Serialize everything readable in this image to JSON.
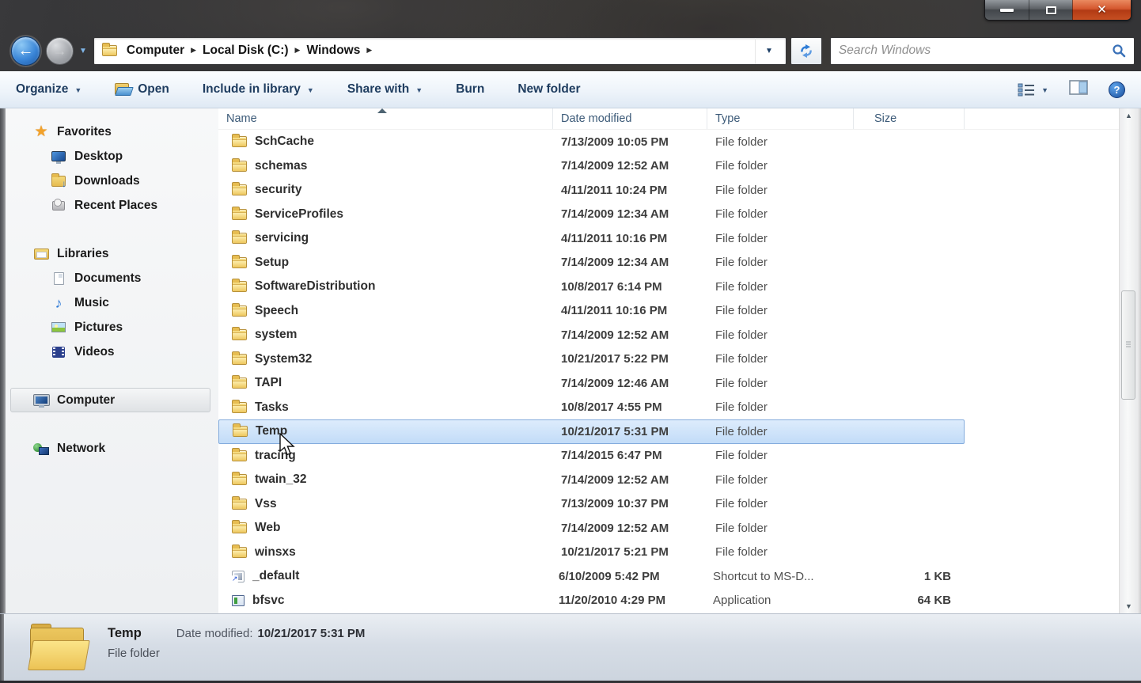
{
  "colors": {
    "selection_border": "#84acdd",
    "selection_fill_top": "#ddecfc",
    "selection_fill_bottom": "#c2dcf8",
    "close_button": "#c74f22",
    "toolbar_text": "#1e3c5f",
    "folder_yellow": "#e7bd52"
  },
  "icons": {
    "back": "←",
    "forward": "→",
    "dropdown_caret": "▼",
    "breadcrumb_separator": "▶",
    "close": "✕",
    "help": "?",
    "star": "★",
    "music_note": "♪",
    "triangle_up": "▲",
    "triangle_down": "▼"
  },
  "address": {
    "breadcrumb": [
      "Computer",
      "Local Disk (C:)",
      "Windows"
    ],
    "search_placeholder": "Search Windows"
  },
  "toolbar": {
    "items": [
      {
        "label": "Organize",
        "dropdown": true
      },
      {
        "label": "Open",
        "icon": "open-folder"
      },
      {
        "label": "Include in library",
        "dropdown": true
      },
      {
        "label": "Share with",
        "dropdown": true
      },
      {
        "label": "Burn"
      },
      {
        "label": "New folder"
      }
    ]
  },
  "sidebar": {
    "items": [
      {
        "label": "Favorites",
        "icon": "star",
        "level": 0
      },
      {
        "label": "Desktop",
        "icon": "desktop",
        "level": 1
      },
      {
        "label": "Downloads",
        "icon": "downloads",
        "level": 1
      },
      {
        "label": "Recent Places",
        "icon": "recent",
        "level": 1
      },
      {
        "label": "Libraries",
        "icon": "libraries",
        "level": 0,
        "gap": true
      },
      {
        "label": "Documents",
        "icon": "document",
        "level": 1
      },
      {
        "label": "Music",
        "icon": "music",
        "level": 1
      },
      {
        "label": "Pictures",
        "icon": "pictures",
        "level": 1
      },
      {
        "label": "Videos",
        "icon": "videos",
        "level": 1
      },
      {
        "label": "Computer",
        "icon": "computer",
        "level": 0,
        "gap": true,
        "selected": true
      },
      {
        "label": "Network",
        "icon": "network",
        "level": 0,
        "gap": true
      }
    ]
  },
  "filelist": {
    "columns": [
      "Name",
      "Date modified",
      "Type",
      "Size"
    ],
    "sort": {
      "column": "Name",
      "direction": "ascending"
    },
    "rows": [
      {
        "name": "SchCache",
        "date": "7/13/2009 10:05 PM",
        "type": "File folder",
        "size": "",
        "icon": "folder"
      },
      {
        "name": "schemas",
        "date": "7/14/2009 12:52 AM",
        "type": "File folder",
        "size": "",
        "icon": "folder"
      },
      {
        "name": "security",
        "date": "4/11/2011 10:24 PM",
        "type": "File folder",
        "size": "",
        "icon": "folder"
      },
      {
        "name": "ServiceProfiles",
        "date": "7/14/2009 12:34 AM",
        "type": "File folder",
        "size": "",
        "icon": "folder"
      },
      {
        "name": "servicing",
        "date": "4/11/2011 10:16 PM",
        "type": "File folder",
        "size": "",
        "icon": "folder"
      },
      {
        "name": "Setup",
        "date": "7/14/2009 12:34 AM",
        "type": "File folder",
        "size": "",
        "icon": "folder"
      },
      {
        "name": "SoftwareDistribution",
        "date": "10/8/2017 6:14 PM",
        "type": "File folder",
        "size": "",
        "icon": "folder"
      },
      {
        "name": "Speech",
        "date": "4/11/2011 10:16 PM",
        "type": "File folder",
        "size": "",
        "icon": "folder"
      },
      {
        "name": "system",
        "date": "7/14/2009 12:52 AM",
        "type": "File folder",
        "size": "",
        "icon": "folder"
      },
      {
        "name": "System32",
        "date": "10/21/2017 5:22 PM",
        "type": "File folder",
        "size": "",
        "icon": "folder"
      },
      {
        "name": "TAPI",
        "date": "7/14/2009 12:46 AM",
        "type": "File folder",
        "size": "",
        "icon": "folder"
      },
      {
        "name": "Tasks",
        "date": "10/8/2017 4:55 PM",
        "type": "File folder",
        "size": "",
        "icon": "folder"
      },
      {
        "name": "Temp",
        "date": "10/21/2017 5:31 PM",
        "type": "File folder",
        "size": "",
        "icon": "folder",
        "selected": true
      },
      {
        "name": "tracing",
        "date": "7/14/2015 6:47 PM",
        "type": "File folder",
        "size": "",
        "icon": "folder"
      },
      {
        "name": "twain_32",
        "date": "7/14/2009 12:52 AM",
        "type": "File folder",
        "size": "",
        "icon": "folder"
      },
      {
        "name": "Vss",
        "date": "7/13/2009 10:37 PM",
        "type": "File folder",
        "size": "",
        "icon": "folder"
      },
      {
        "name": "Web",
        "date": "7/14/2009 12:52 AM",
        "type": "File folder",
        "size": "",
        "icon": "folder"
      },
      {
        "name": "winsxs",
        "date": "10/21/2017 5:21 PM",
        "type": "File folder",
        "size": "",
        "icon": "folder"
      },
      {
        "name": "_default",
        "date": "6/10/2009 5:42 PM",
        "type": "Shortcut to MS-D...",
        "size": "1 KB",
        "icon": "shortcut"
      },
      {
        "name": "bfsvc",
        "date": "11/20/2010 4:29 PM",
        "type": "Application",
        "size": "64 KB",
        "icon": "application"
      }
    ]
  },
  "details": {
    "name": "Temp",
    "date_label": "Date modified:",
    "date_value": "10/21/2017 5:31 PM",
    "type": "File folder"
  }
}
